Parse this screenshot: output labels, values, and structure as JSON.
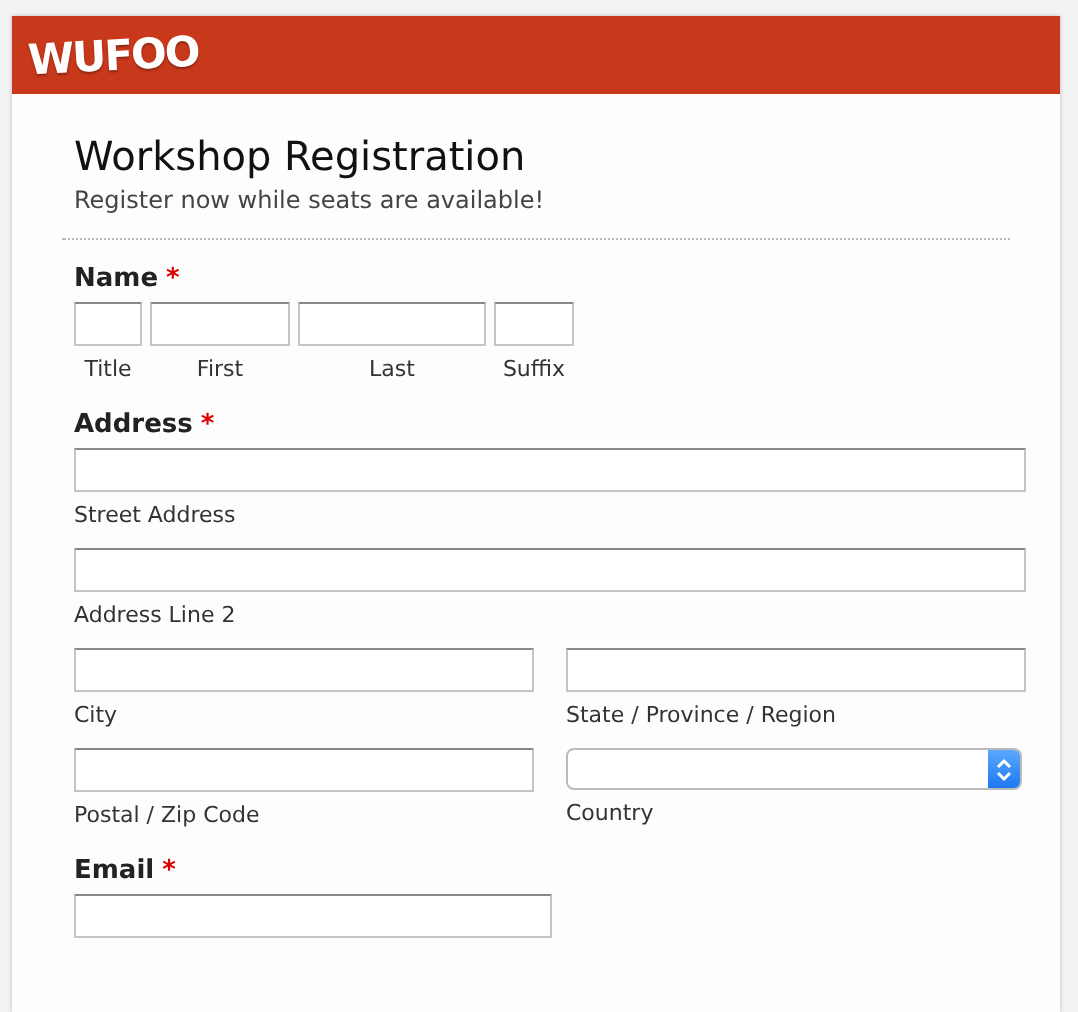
{
  "logo": "WUFOO",
  "form": {
    "title": "Workshop Registration",
    "description": "Register now while seats are available!"
  },
  "fields": [
    {
      "kind": "name",
      "label": "Name",
      "required_mark": "*",
      "parts": [
        {
          "sublabel": "Title"
        },
        {
          "sublabel": "First"
        },
        {
          "sublabel": "Last"
        },
        {
          "sublabel": "Suffix"
        }
      ]
    },
    {
      "kind": "address",
      "label": "Address",
      "required_mark": "*",
      "parts": [
        {
          "kind": "line",
          "sublabel": "Street Address"
        },
        {
          "kind": "line",
          "sublabel": "Address Line 2"
        },
        {
          "kind": "text",
          "sublabel": "City"
        },
        {
          "kind": "text",
          "sublabel": "State / Province / Region"
        },
        {
          "kind": "text",
          "sublabel": "Postal / Zip Code"
        },
        {
          "kind": "select",
          "sublabel": "Country"
        }
      ]
    },
    {
      "kind": "email",
      "label": "Email",
      "required_mark": "*"
    }
  ]
}
